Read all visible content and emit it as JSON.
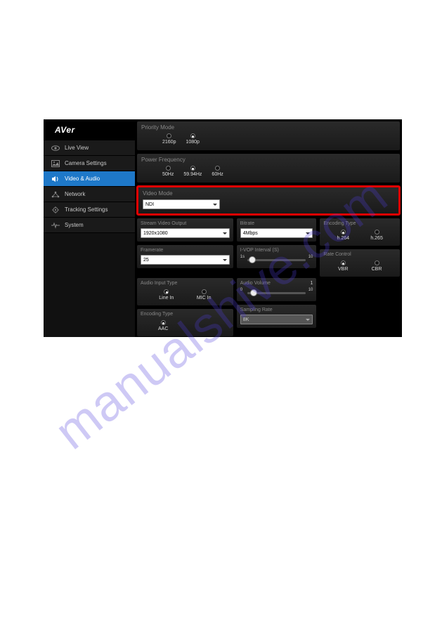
{
  "logo": "AVer",
  "watermark": "manualshive.com",
  "sidebar": {
    "items": [
      {
        "label": "Live View",
        "icon": "eye",
        "active": false
      },
      {
        "label": "Camera Settings",
        "icon": "image",
        "active": false
      },
      {
        "label": "Video & Audio",
        "icon": "speaker",
        "active": true
      },
      {
        "label": "Network",
        "icon": "network",
        "active": false
      },
      {
        "label": "Tracking Settings",
        "icon": "target",
        "active": false
      },
      {
        "label": "System",
        "icon": "pulse",
        "active": false
      }
    ]
  },
  "priority_mode": {
    "title": "Priority Mode",
    "options": [
      "2160p",
      "1080p"
    ],
    "selected": "1080p"
  },
  "power_frequency": {
    "title": "Power Frequency",
    "options": [
      "50Hz",
      "59.94Hz",
      "60Hz"
    ],
    "selected": "59.94Hz"
  },
  "video_mode": {
    "title": "Video Mode",
    "value": "NDI"
  },
  "stream_video_output": {
    "title": "Stream Video Output",
    "value": "1920x1080"
  },
  "bitrate": {
    "title": "Bitrate",
    "value": "4Mbps"
  },
  "encoding_type_video": {
    "title": "Encoding Type",
    "options": [
      "h.264",
      "h.265"
    ],
    "selected": "h.264"
  },
  "framerate": {
    "title": "Framerate",
    "value": "25"
  },
  "ivop_interval": {
    "title": "I-VOP Interval (S)",
    "min": "1s",
    "max": "10",
    "value": 1
  },
  "rate_control": {
    "title": "Rate Control",
    "options": [
      "VBR",
      "CBR"
    ],
    "selected": "VBR"
  },
  "audio_input_type": {
    "title": "Audio Input Type",
    "options": [
      "Line In",
      "MIC In"
    ],
    "selected": "Line In"
  },
  "audio_volume": {
    "title": "Audio Volume",
    "min": "0",
    "max": "10",
    "side_label": "1",
    "value": 1
  },
  "encoding_type_audio": {
    "title": "Encoding Type",
    "options": [
      "AAC"
    ],
    "selected": "AAC"
  },
  "sampling_rate": {
    "title": "Sampling Rate",
    "value": "8K"
  }
}
